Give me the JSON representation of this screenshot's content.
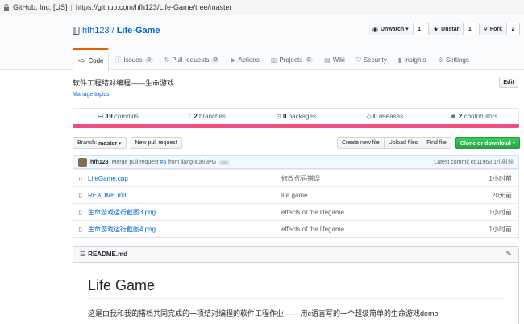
{
  "addressbar": {
    "org": "GitHub, Inc. [US]",
    "separator": "|",
    "url": "https://github.com/hfh123/Life-Game/tree/master"
  },
  "repo": {
    "owner": "hfh123",
    "slash": "/",
    "name": "Life-Game"
  },
  "actions": {
    "watch_label": "Unwatch ▾",
    "watch_count": "1",
    "star_label": "Unstar",
    "star_count": "1",
    "fork_label": "Fork",
    "fork_count": "2"
  },
  "tabs": [
    {
      "label": "Code",
      "icon": "code-icon",
      "badge": ""
    },
    {
      "label": "Issues",
      "icon": "issue-icon",
      "badge": "0"
    },
    {
      "label": "Pull requests",
      "icon": "pull-request-icon",
      "badge": "0"
    },
    {
      "label": "Actions",
      "icon": "play-icon",
      "badge": ""
    },
    {
      "label": "Projects",
      "icon": "project-icon",
      "badge": "0"
    },
    {
      "label": "Wiki",
      "icon": "book-icon",
      "badge": ""
    },
    {
      "label": "Security",
      "icon": "shield-icon",
      "badge": ""
    },
    {
      "label": "Insights",
      "icon": "graph-icon",
      "badge": ""
    },
    {
      "label": "Settings",
      "icon": "gear-icon",
      "badge": ""
    }
  ],
  "description": "软件工程结对编程——生命游戏",
  "manage_topics": "Manage topics",
  "edit_label": "Edit",
  "summary": {
    "commits_num": "19",
    "commits_label": "commits",
    "branches_num": "2",
    "branches_label": "branches",
    "packages_num": "0",
    "packages_label": "packages",
    "releases_num": "0",
    "releases_label": "releases",
    "contributors_num": "2",
    "contributors_label": "contributors"
  },
  "language_color": "#f34b7d",
  "filenav": {
    "branch_prefix": "Branch:",
    "branch_name": "master ▾",
    "new_pull_request": "New pull request",
    "create_new_file": "Create new file",
    "upload_files": "Upload files",
    "find_file": "Find file",
    "clone_download": "Clone or download ▾"
  },
  "commit": {
    "author": "hfh123",
    "message_prefix": "Merge pull request",
    "pr": "#5",
    "message_suffix": "from liang-xue/JPG",
    "dots": "…",
    "latest": "Latest commit c611963 1小时前"
  },
  "files": [
    {
      "name": "LifeGame.cpp",
      "message": "修改代码错误",
      "age": "1小时前"
    },
    {
      "name": "README.md",
      "message": "life game",
      "age": "20天前"
    },
    {
      "name": "生命游戏运行截图3.png",
      "message": "effects of the lifegame",
      "age": "1小时前"
    },
    {
      "name": "生命游戏运行截图4.png",
      "message": "effects of the lifegame",
      "age": "1小时前"
    }
  ],
  "readme": {
    "filename": "README.md",
    "title": "Life Game",
    "body": "这是由我和我的搭档共同完成的一项结对编程的软件工程作业 ——用c语言写的一个超级简单的生命游戏demo"
  }
}
